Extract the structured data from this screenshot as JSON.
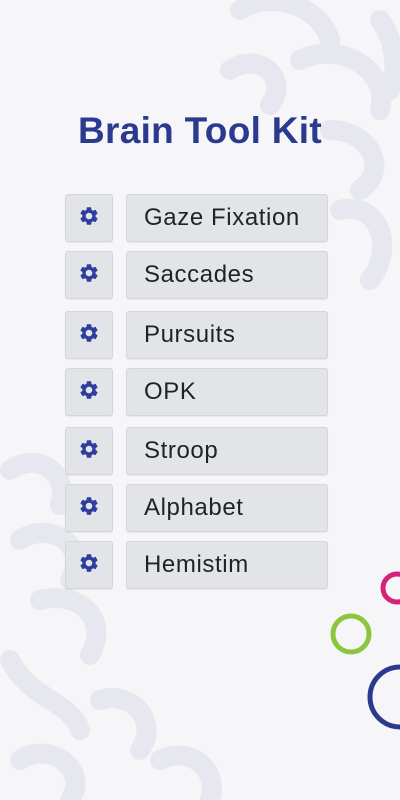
{
  "page": {
    "title": "Brain Tool Kit"
  },
  "colors": {
    "title": "#2b3a8f",
    "gear": "#2f3e9e",
    "ring_magenta": "#d4237a",
    "ring_green": "#8cc63f",
    "ring_navy": "#2b3a8f"
  },
  "tools": [
    {
      "label": "Gaze Fixation",
      "icon": "gear-icon"
    },
    {
      "label": "Saccades",
      "icon": "gear-icon"
    },
    {
      "label": "Pursuits",
      "icon": "gear-icon"
    },
    {
      "label": "OPK",
      "icon": "gear-icon"
    },
    {
      "label": "Stroop",
      "icon": "gear-icon"
    },
    {
      "label": "Alphabet",
      "icon": "gear-icon"
    },
    {
      "label": "Hemistim",
      "icon": "gear-icon"
    }
  ]
}
